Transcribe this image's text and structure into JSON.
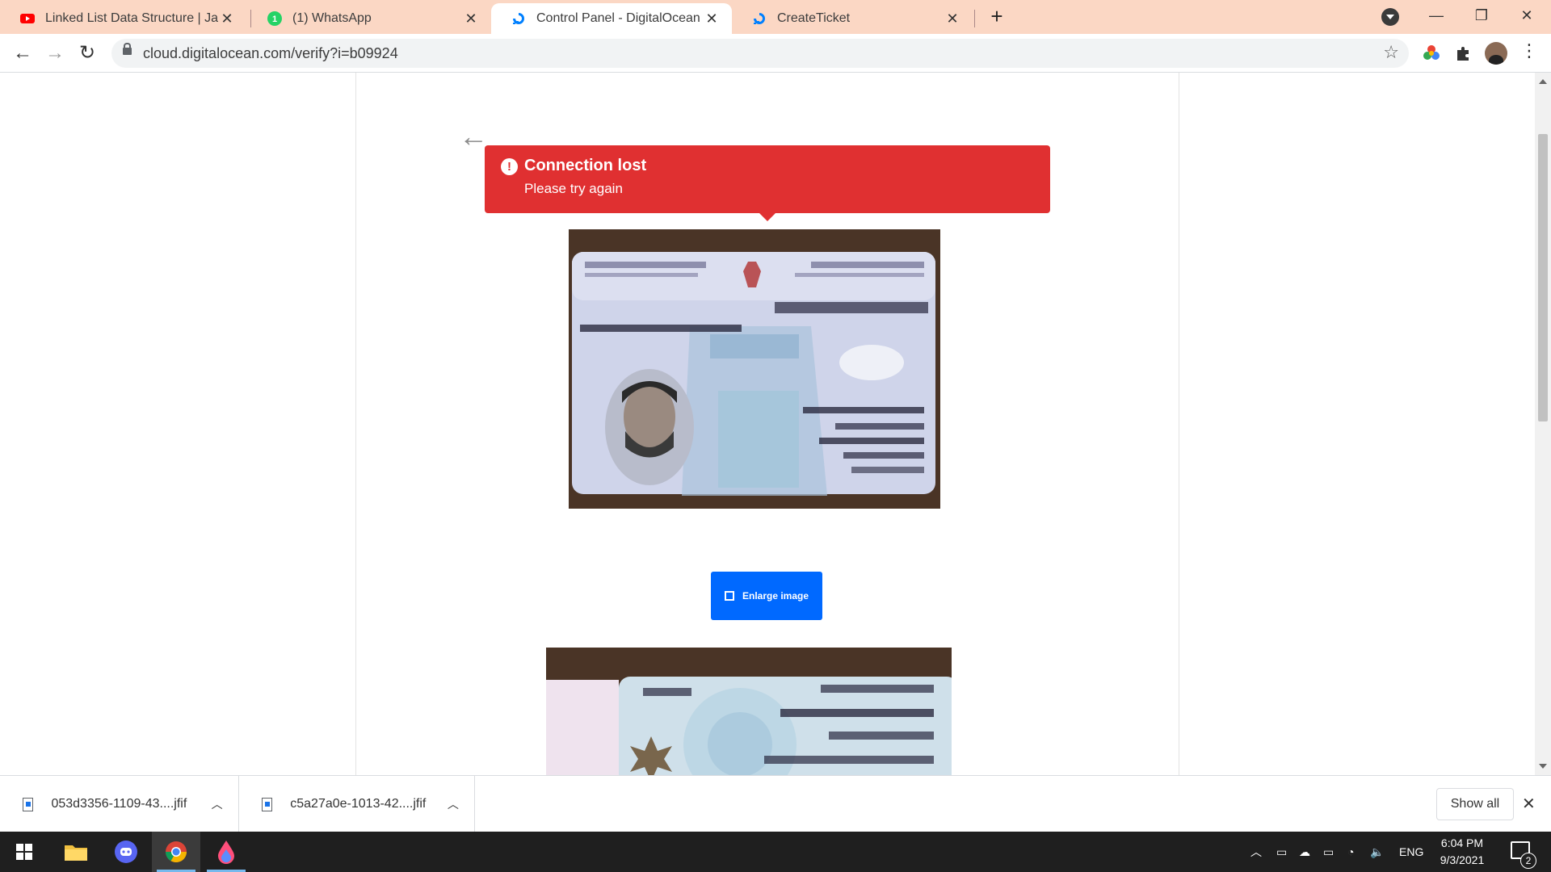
{
  "browser": {
    "tabs": [
      {
        "title": "Linked List Data Structure | JavaS",
        "favicon": "youtube-icon",
        "active": false
      },
      {
        "title": "(1) WhatsApp",
        "favicon": "whatsapp-icon",
        "active": false
      },
      {
        "title": "Control Panel - DigitalOcean",
        "favicon": "digitalocean-icon",
        "active": true
      },
      {
        "title": "CreateTicket",
        "favicon": "digitalocean-icon",
        "active": false
      }
    ],
    "new_tab_label": "+",
    "url": "cloud.digitalocean.com/verify?i=b09924"
  },
  "page": {
    "toast": {
      "title": "Connection lost",
      "message": "Please try again",
      "icon": "alert-circle-icon"
    },
    "enlarge_button": "Enlarge image"
  },
  "downloads": {
    "items": [
      {
        "name": "053d3356-1109-43....jfif"
      },
      {
        "name": "c5a27a0e-1013-42....jfif"
      }
    ],
    "show_all": "Show all"
  },
  "taskbar": {
    "apps": [
      "windows-start-icon",
      "file-explorer-icon",
      "discord-icon",
      "chrome-icon",
      "paint-drop-icon"
    ],
    "language": "ENG",
    "time": "6:04 PM",
    "date": "9/3/2021",
    "notification_count": "2"
  },
  "colors": {
    "tab_strip": "#fbd7c4",
    "toast": "#e03031",
    "primary_button": "#0069ff"
  }
}
